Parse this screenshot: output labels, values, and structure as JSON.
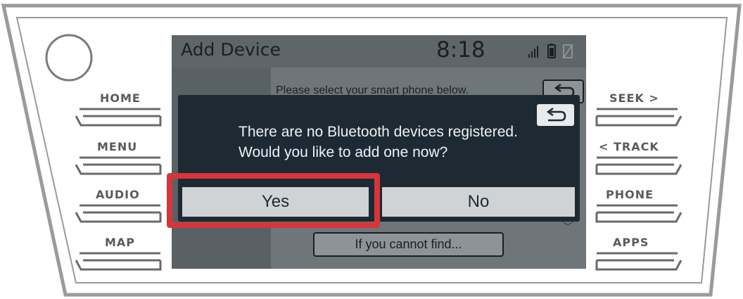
{
  "hardware": {
    "left_buttons": [
      {
        "id": "home",
        "label": "HOME"
      },
      {
        "id": "menu",
        "label": "MENU"
      },
      {
        "id": "audio",
        "label": "AUDIO"
      },
      {
        "id": "map",
        "label": "MAP"
      }
    ],
    "right_buttons": [
      {
        "id": "seek",
        "label": "SEEK >"
      },
      {
        "id": "track",
        "label": "< TRACK"
      },
      {
        "id": "phone",
        "label": "PHONE"
      },
      {
        "id": "apps",
        "label": "APPS"
      }
    ]
  },
  "status_bar": {
    "title": "Add Device",
    "time": "8:18",
    "icons": [
      "signal-icon",
      "battery-icon",
      "no-connection-icon"
    ]
  },
  "background_screen": {
    "instruction": "Please select your smart phone below.",
    "back_icon": "back-arrow-icon",
    "find_button_label": "If you cannot find...",
    "scroll_icon": "chevron-down-icon"
  },
  "dialog": {
    "message_line1": "There are no Bluetooth devices registered.",
    "message_line2": "Would you like to add one now?",
    "back_icon": "back-arrow-icon",
    "yes_label": "Yes",
    "no_label": "No"
  },
  "annotation": {
    "highlight_target": "yes-button",
    "color": "#d8353b"
  }
}
